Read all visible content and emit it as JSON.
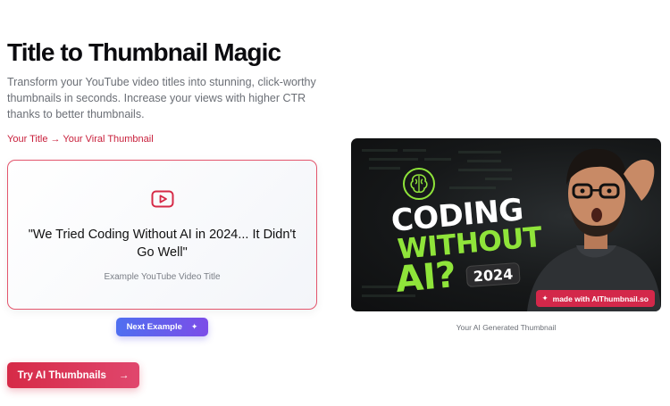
{
  "hero": {
    "title": "Title to Thumbnail Magic",
    "description": "Transform your YouTube video titles into stunning, click-worthy thumbnails in seconds. Increase your views with higher CTR thanks to better thumbnails.",
    "tagline": "Your Title → Your Viral Thumbnail"
  },
  "example": {
    "icon": "youtube-icon",
    "title": "\"We Tried Coding Without AI in 2024... It Didn't Go Well\"",
    "caption": "Example YouTube Video Title",
    "next_label": "Next Example",
    "next_icon": "sparkles-icon"
  },
  "cta": {
    "label": "Try AI Thumbnails",
    "arrow": "→"
  },
  "thumbnail": {
    "line1": "CODING",
    "line2": "WITHOUT",
    "line3": "AI?",
    "year": "2024",
    "badge": "made with AIThumbnail.so",
    "caption": "Your AI Generated Thumbnail"
  },
  "colors": {
    "accent": "#d62a47",
    "next_gradient_start": "#4f6ff0",
    "next_gradient_end": "#7c4de8",
    "thumbnail_green": "#8fe43a"
  }
}
